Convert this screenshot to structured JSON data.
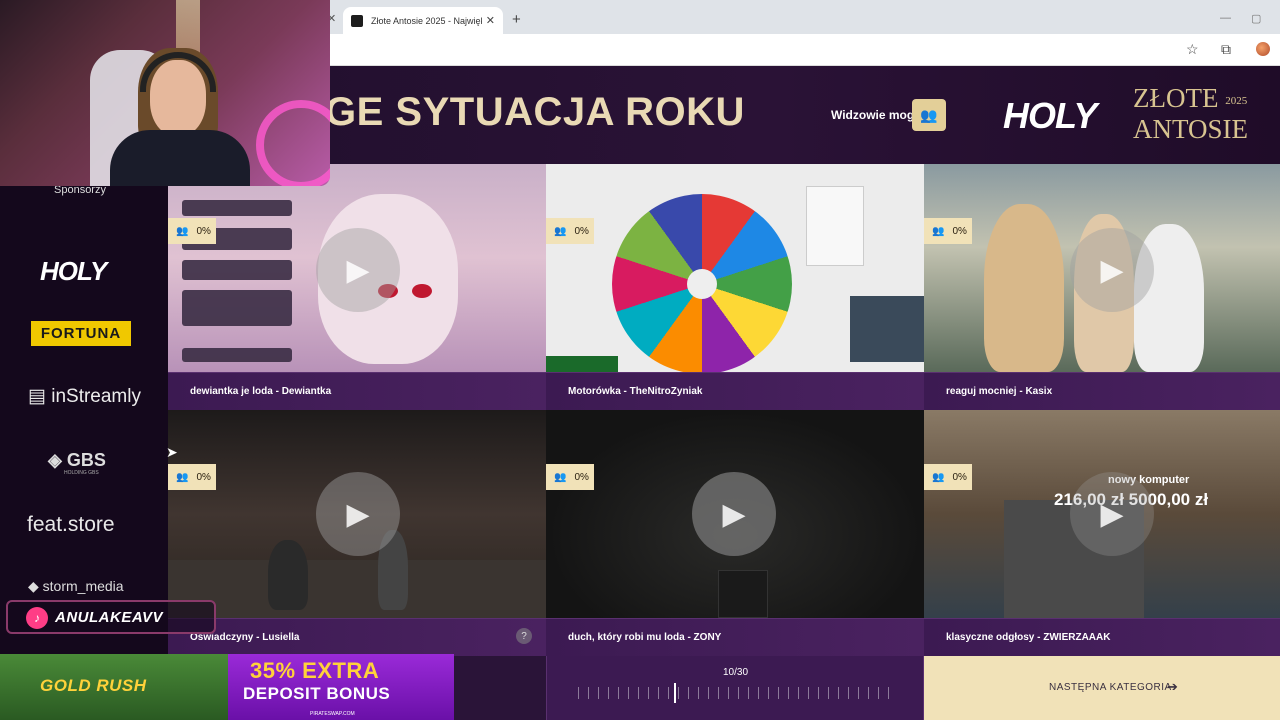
{
  "browser": {
    "tab_title": "Złote Antosie 2025 - Największ",
    "new_tab": "+",
    "tab_close": "✕"
  },
  "header": {
    "category_title": "GE SYTUACJA ROKU",
    "viewers_label": "Widzowie mogą",
    "brand": "HOLY",
    "event_line1": "ZŁOTE",
    "event_year": "2025",
    "event_line2": "ANTOSIE"
  },
  "sidebar": {
    "sponsors_label": "Sponsorzy",
    "sponsors": [
      "HOLY",
      "FORTUNA",
      "inStreamly",
      "GBS",
      "feat.store",
      "storm_media"
    ],
    "gbs_sub": "HOLDING GBS"
  },
  "overlay": {
    "tiktok_handle": "ANULAKEAVV"
  },
  "grid": {
    "tiles": [
      {
        "title": "dewiantka je loda - Dewiantka",
        "percent": "0%"
      },
      {
        "title": "Motorówka - TheNitroZyniak",
        "percent": "0%"
      },
      {
        "title": "reaguj mocniej - Kasix",
        "percent": "0%"
      },
      {
        "title": "Oświadczyny - Lusiella",
        "percent": "0%"
      },
      {
        "title": "duch, który robi mu loda - ZONY",
        "percent": "0%"
      },
      {
        "title": "klasyczne odgłosy - ZWIERZAAAK",
        "percent": "0%"
      }
    ],
    "mc_overlay_label": "nowy komputer",
    "mc_overlay_amounts": "216,00 zł  5000,00 zł",
    "help": "?"
  },
  "footer": {
    "progress": "10/30",
    "progress_value": 10,
    "progress_total": 30,
    "next_category": "NASTĘPNA KATEGORIA"
  },
  "ad": {
    "left_text": "GOLD RUSH",
    "percent_text": "35% EXTRA",
    "bonus_text": "DEPOSIT BONUS",
    "url": "PIRATESWAP.COM"
  },
  "colors": {
    "accent_gold": "#f1e2b8",
    "panel_purple": "#3c1a52",
    "page_bg": "#1a0b22"
  }
}
